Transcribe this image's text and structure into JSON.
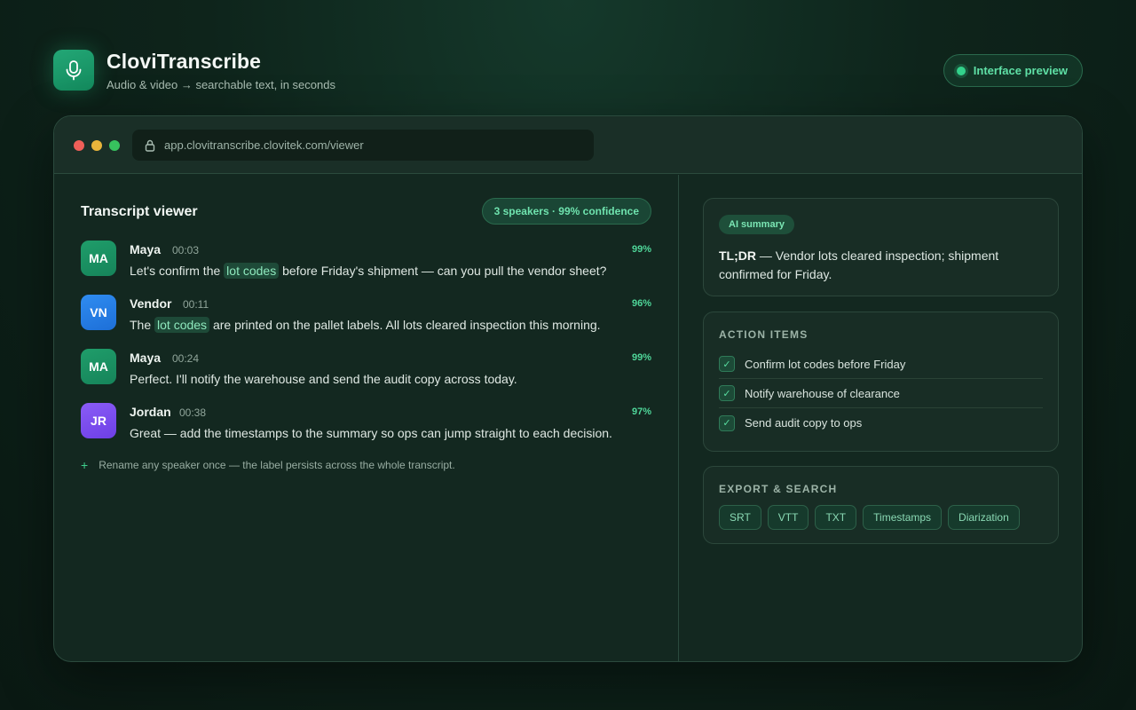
{
  "brand": {
    "name": "CloviTranscribe",
    "tagline": "Audio & video → searchable text, in seconds",
    "preview_label": "Interface preview"
  },
  "browser": {
    "url": "app.clovitranscribe.clovitek.com/viewer"
  },
  "transcript": {
    "title": "Transcript viewer",
    "badge": "3 speakers · 99% confidence",
    "entries": [
      {
        "initials": "MA",
        "speaker": "Maya",
        "time": "00:03",
        "confidence": "99%",
        "text_before": "Let's confirm the ",
        "highlight": "lot codes",
        "text_after": " before Friday's shipment — can you pull the vendor sheet?"
      },
      {
        "initials": "VN",
        "speaker": "Vendor",
        "time": "00:11",
        "confidence": "96%",
        "text_before": "The ",
        "highlight": "lot codes",
        "text_after": " are printed on the pallet labels. All lots cleared inspection this morning."
      },
      {
        "initials": "MA",
        "speaker": "Maya",
        "time": "00:24",
        "confidence": "99%",
        "text": "Perfect. I'll notify the warehouse and send the audit copy across today."
      },
      {
        "initials": "JR",
        "speaker": "Jordan",
        "time": "00:38",
        "confidence": "97%",
        "text": "Great — add the timestamps to the summary so ops can jump straight to each decision."
      }
    ],
    "tip_icon": "+",
    "tip": "Rename any speaker once — the label persists across the whole transcript."
  },
  "summary": {
    "badge": "AI summary",
    "tldr_label": "TL;DR",
    "tldr_text": " — Vendor lots cleared inspection; shipment confirmed for Friday."
  },
  "actions": {
    "heading": "ACTION ITEMS",
    "items": [
      {
        "label": "Confirm lot codes before Friday",
        "checked": true
      },
      {
        "label": "Notify warehouse of clearance",
        "checked": true
      },
      {
        "label": "Send audit copy to ops",
        "checked": true
      }
    ]
  },
  "export": {
    "heading": "EXPORT & SEARCH",
    "chips": [
      "SRT",
      "VTT",
      "TXT",
      "Timestamps",
      "Diarization"
    ]
  },
  "colors": {
    "accent": "#33d18b",
    "background": "#0e241b",
    "avatar_green": "#1f9d6a",
    "avatar_blue": "#2f8cf0",
    "avatar_purple": "#8a5cf6"
  },
  "icons": {
    "logo": "microphone-icon",
    "url": "lock-icon",
    "check": "checkmark-icon"
  }
}
